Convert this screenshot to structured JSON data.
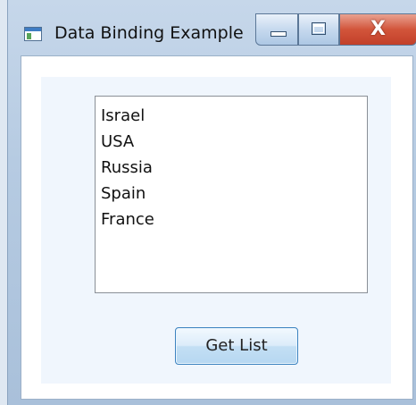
{
  "window": {
    "title": "Data Binding Example",
    "icons": {
      "app": "window-app-icon",
      "minimize": "minimize-icon",
      "maximize": "maximize-icon",
      "close": "close-icon",
      "close_glyph": "X"
    }
  },
  "list": {
    "items": [
      "Israel",
      "USA",
      "Russia",
      "Spain",
      "France"
    ]
  },
  "button": {
    "label": "Get List"
  },
  "colors": {
    "close_button": "#d2553b",
    "panel_background": "#f0f6fd",
    "button_border": "#3d83c0"
  }
}
